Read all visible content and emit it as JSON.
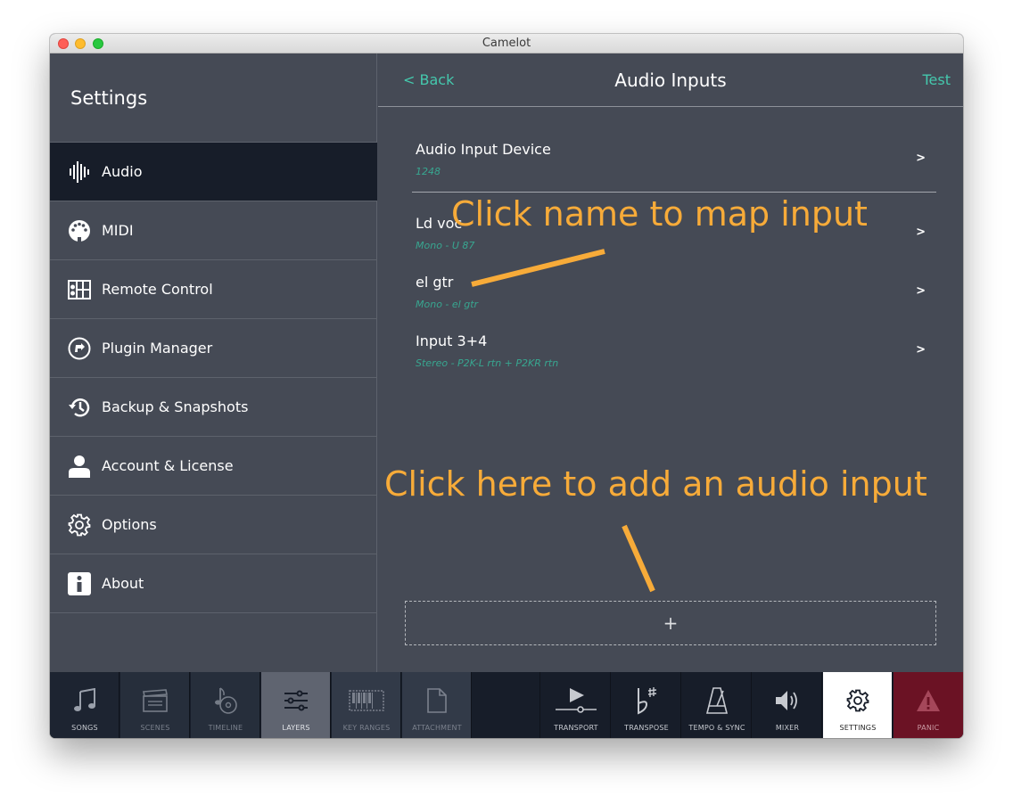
{
  "window": {
    "title": "Camelot"
  },
  "sidebar": {
    "title": "Settings",
    "items": [
      {
        "label": "Audio",
        "icon": "audio-waveform-icon",
        "active": true
      },
      {
        "label": "MIDI",
        "icon": "midi-connector-icon"
      },
      {
        "label": "Remote Control",
        "icon": "remote-control-icon"
      },
      {
        "label": "Plugin Manager",
        "icon": "plugin-icon"
      },
      {
        "label": "Backup & Snapshots",
        "icon": "history-icon"
      },
      {
        "label": "Account & License",
        "icon": "user-icon"
      },
      {
        "label": "Options",
        "icon": "gear-icon"
      },
      {
        "label": "About",
        "icon": "info-icon"
      }
    ]
  },
  "header": {
    "back_label": "< Back",
    "title": "Audio Inputs",
    "test_label": "Test"
  },
  "device": {
    "name": "Audio Input Device",
    "value": "1248",
    "chevron": ">"
  },
  "inputs": [
    {
      "name": "Ld voc",
      "detail": "Mono - U 87",
      "chevron": ">"
    },
    {
      "name": "el gtr",
      "detail": "Mono - el gtr",
      "chevron": ">"
    },
    {
      "name": "Input 3+4",
      "detail": "Stereo - P2K-L rtn + P2KR rtn",
      "chevron": ">"
    }
  ],
  "add_button": {
    "label": "+"
  },
  "annotations": {
    "map_hint": "Click name to map input",
    "add_hint": "Click here to add an audio input",
    "color": "#f7ab39"
  },
  "tabs": [
    {
      "label": "SONGS",
      "icon": "music-note-icon"
    },
    {
      "label": "SCENES",
      "icon": "clapperboard-icon"
    },
    {
      "label": "TIMELINE",
      "icon": "timeline-icon"
    },
    {
      "label": "LAYERS",
      "icon": "sliders-icon"
    },
    {
      "label": "KEY RANGES",
      "icon": "keyboard-icon"
    },
    {
      "label": "ATTACHMENT",
      "icon": "document-icon"
    },
    {
      "label": "TRANSPORT",
      "icon": "play-icon"
    },
    {
      "label": "TRANSPOSE",
      "icon": "flat-sharp-icon"
    },
    {
      "label": "TEMPO & SYNC",
      "icon": "metronome-icon"
    },
    {
      "label": "MIXER",
      "icon": "speaker-icon"
    },
    {
      "label": "SETTINGS",
      "icon": "gear-icon"
    },
    {
      "label": "PANIC",
      "icon": "warning-icon"
    }
  ],
  "colors": {
    "accent": "#45c8ad",
    "sidebar_active": "#171d29",
    "panel": "#454a55",
    "panic": "#6b1224"
  }
}
